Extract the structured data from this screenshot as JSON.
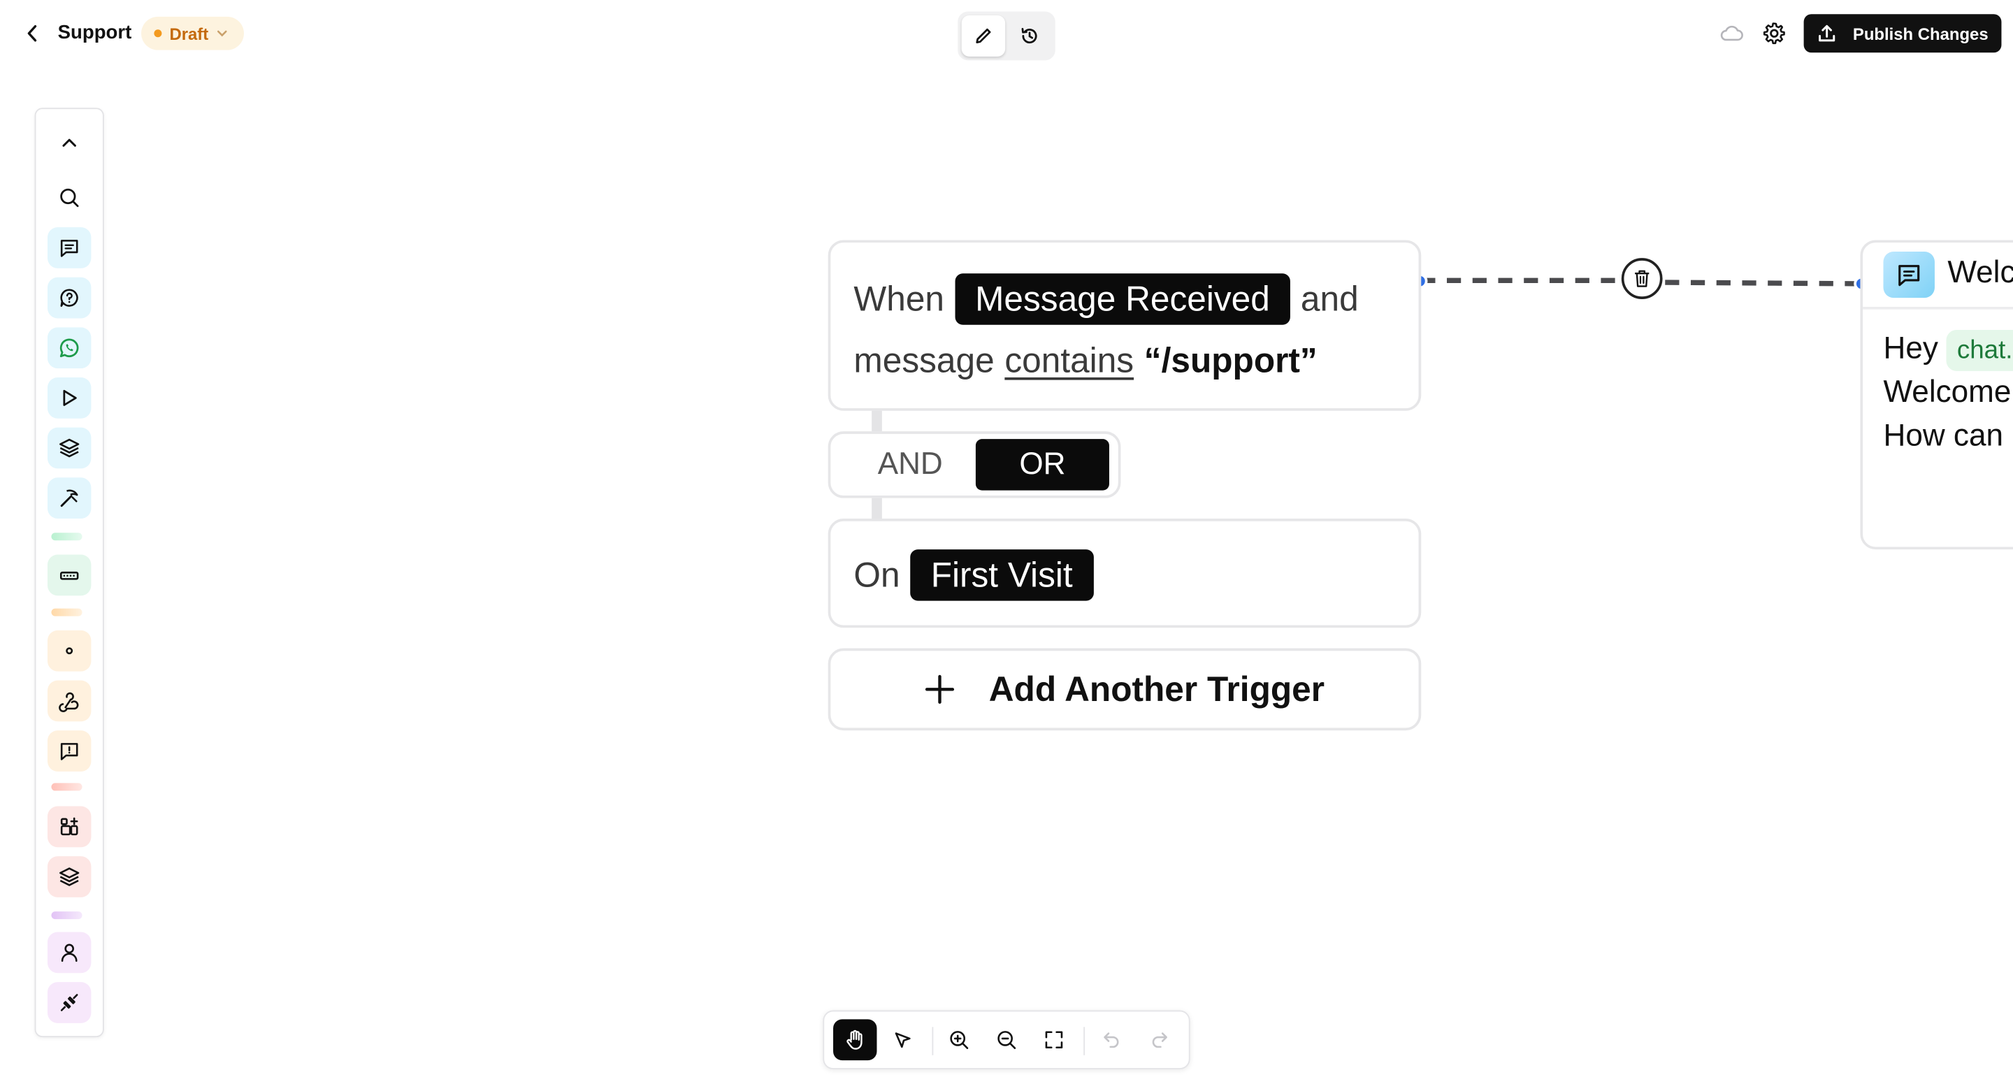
{
  "header": {
    "title": "Support",
    "status": "Draft",
    "publish_label": "Publish Changes"
  },
  "sidebar": {
    "tools": [
      {
        "name": "collapse",
        "icon": "chevron-up-icon"
      },
      {
        "name": "search",
        "icon": "search-icon"
      },
      {
        "name": "message",
        "icon": "message-square-icon",
        "color": "#e2f6fd"
      },
      {
        "name": "question-bubble",
        "icon": "help-bubble-icon",
        "color": "#e2f6fd"
      },
      {
        "name": "whatsapp",
        "icon": "whatsapp-icon",
        "color": "#e2f6fd"
      },
      {
        "name": "play",
        "icon": "play-icon",
        "color": "#e2f6fd"
      },
      {
        "name": "layers",
        "icon": "layers-icon",
        "color": "#e2f6fd"
      },
      {
        "name": "wand",
        "icon": "wand-icon",
        "color": "#e2f6fd"
      },
      {
        "name": "keyboard",
        "icon": "keyboard-icon",
        "color": "#e4f7ec"
      },
      {
        "name": "dot",
        "icon": "dot-icon",
        "color": "#fff1de"
      },
      {
        "name": "webhook",
        "icon": "webhook-icon",
        "color": "#fff1de"
      },
      {
        "name": "feedback",
        "icon": "message-alert-icon",
        "color": "#fff1de"
      },
      {
        "name": "apps",
        "icon": "apps-add-icon",
        "color": "#fde6e4"
      },
      {
        "name": "stack",
        "icon": "layers-icon",
        "color": "#fde6e4"
      },
      {
        "name": "user",
        "icon": "user-icon",
        "color": "#f7e8fb"
      },
      {
        "name": "plug",
        "icon": "plug-icon",
        "color": "#f7e8fb"
      }
    ]
  },
  "trigger1": {
    "when": "When",
    "event": "Message Received",
    "and": "and",
    "subject": "message",
    "operator": "contains",
    "value": "“/support”"
  },
  "logic": {
    "and_label": "AND",
    "or_label": "OR",
    "selected": "OR"
  },
  "trigger2": {
    "on": "On",
    "event": "First Visit"
  },
  "add_trigger_label": "Add Another Trigger",
  "message_card": {
    "title": "Welc",
    "line1_prefix": "Hey",
    "variable": "chat.",
    "line2": "Welcome",
    "line3": "How can"
  },
  "colors": {
    "accent": "#2f6fe4",
    "primary_dark": "#0b0b0b",
    "draft": "#c46a0d"
  }
}
